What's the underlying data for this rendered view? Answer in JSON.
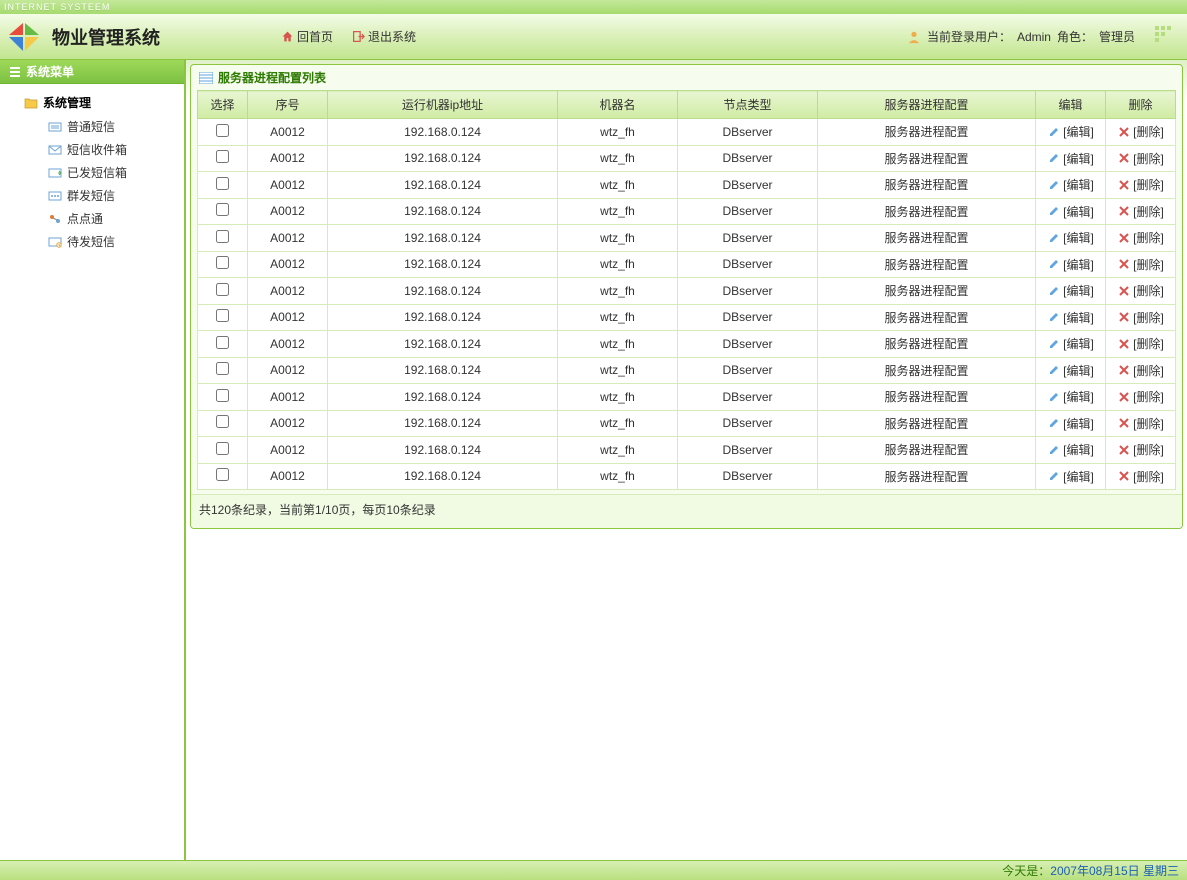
{
  "top_strip": "INTERNET SYSTEEM",
  "header": {
    "app_title": "物业管理系统",
    "home_label": "回首页",
    "exit_label": "退出系统",
    "user_prefix": "当前登录用户：",
    "user": "Admin",
    "role_prefix": "角色：",
    "role": "管理员"
  },
  "sidebar": {
    "title": "系统菜单",
    "group": "系统管理",
    "items": [
      {
        "label": "普通短信"
      },
      {
        "label": "短信收件箱"
      },
      {
        "label": "已发短信箱"
      },
      {
        "label": "群发短信"
      },
      {
        "label": "点点通"
      },
      {
        "label": "待发短信"
      }
    ]
  },
  "panel": {
    "title": "服务器进程配置列表"
  },
  "table": {
    "headers": {
      "select": "选择",
      "seq": "序号",
      "ip": "运行机器ip地址",
      "machine": "机器名",
      "node_type": "节点类型",
      "proc": "服务器进程配置",
      "edit": "编辑",
      "delete": "删除"
    },
    "edit_label": "[编辑]",
    "delete_label": "[删除]",
    "rows": [
      {
        "seq": "A0012",
        "ip": "192.168.0.124",
        "machine": "wtz_fh",
        "node_type": "DBserver",
        "proc": "服务器进程配置"
      },
      {
        "seq": "A0012",
        "ip": "192.168.0.124",
        "machine": "wtz_fh",
        "node_type": "DBserver",
        "proc": "服务器进程配置"
      },
      {
        "seq": "A0012",
        "ip": "192.168.0.124",
        "machine": "wtz_fh",
        "node_type": "DBserver",
        "proc": "服务器进程配置"
      },
      {
        "seq": "A0012",
        "ip": "192.168.0.124",
        "machine": "wtz_fh",
        "node_type": "DBserver",
        "proc": "服务器进程配置"
      },
      {
        "seq": "A0012",
        "ip": "192.168.0.124",
        "machine": "wtz_fh",
        "node_type": "DBserver",
        "proc": "服务器进程配置"
      },
      {
        "seq": "A0012",
        "ip": "192.168.0.124",
        "machine": "wtz_fh",
        "node_type": "DBserver",
        "proc": "服务器进程配置"
      },
      {
        "seq": "A0012",
        "ip": "192.168.0.124",
        "machine": "wtz_fh",
        "node_type": "DBserver",
        "proc": "服务器进程配置"
      },
      {
        "seq": "A0012",
        "ip": "192.168.0.124",
        "machine": "wtz_fh",
        "node_type": "DBserver",
        "proc": "服务器进程配置"
      },
      {
        "seq": "A0012",
        "ip": "192.168.0.124",
        "machine": "wtz_fh",
        "node_type": "DBserver",
        "proc": "服务器进程配置"
      },
      {
        "seq": "A0012",
        "ip": "192.168.0.124",
        "machine": "wtz_fh",
        "node_type": "DBserver",
        "proc": "服务器进程配置"
      },
      {
        "seq": "A0012",
        "ip": "192.168.0.124",
        "machine": "wtz_fh",
        "node_type": "DBserver",
        "proc": "服务器进程配置"
      },
      {
        "seq": "A0012",
        "ip": "192.168.0.124",
        "machine": "wtz_fh",
        "node_type": "DBserver",
        "proc": "服务器进程配置"
      },
      {
        "seq": "A0012",
        "ip": "192.168.0.124",
        "machine": "wtz_fh",
        "node_type": "DBserver",
        "proc": "服务器进程配置"
      },
      {
        "seq": "A0012",
        "ip": "192.168.0.124",
        "machine": "wtz_fh",
        "node_type": "DBserver",
        "proc": "服务器进程配置"
      }
    ]
  },
  "pager": "共120条纪录，当前第1/10页，每页10条纪录",
  "footer": {
    "today_prefix": "今天是：",
    "today": "2007年08月15日 星期三"
  }
}
